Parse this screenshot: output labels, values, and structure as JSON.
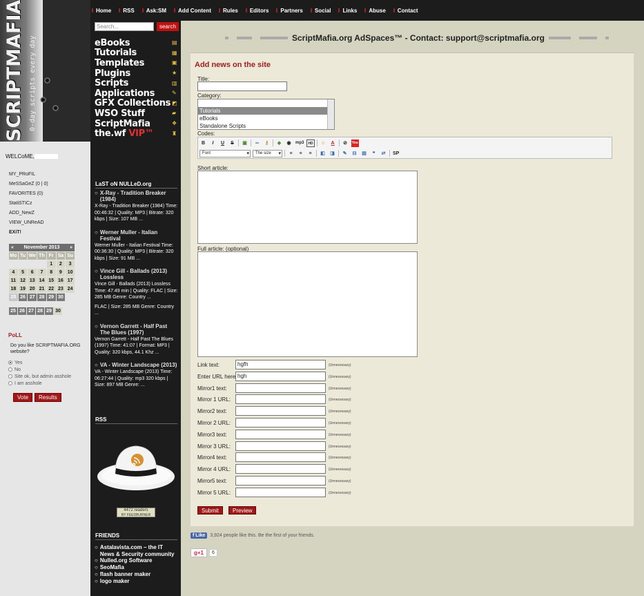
{
  "nav": {
    "items": [
      "Home",
      "RSS",
      "Ask:SM",
      "Add Content",
      "Rules",
      "Editors",
      "Partners",
      "Social",
      "Links",
      "Abuse",
      "Contact"
    ]
  },
  "logo": {
    "title": "SCRIPTMAFIA.ORG",
    "tagline": "0-day scripts every day"
  },
  "user": {
    "welcome": "WELCoME,",
    "menu": [
      "MY_PRoFIL",
      "MeSSaGeZ (0 | 0)",
      "FAVORITES (0)",
      "StatiSTICz",
      "ADD_NewZ",
      "VIEW_UNReAD",
      "EXiT!"
    ]
  },
  "calendar": {
    "month": "November 2013",
    "prev": "«",
    "next": "»",
    "weekdays": [
      "Mo",
      "Tu",
      "We",
      "Th",
      "Fr",
      "Sa",
      "Su"
    ],
    "weeks": [
      [
        "",
        "",
        "",
        "",
        "1",
        "2",
        "3"
      ],
      [
        "4",
        "5",
        "6",
        "7",
        "8",
        "9",
        "10"
      ],
      [
        "11",
        "12",
        "13",
        "14",
        "15",
        "16",
        "17"
      ],
      [
        "18",
        "19",
        "20",
        "21",
        "22",
        "23",
        "24"
      ],
      [
        "25",
        "26",
        "27",
        "28",
        "29",
        "30",
        ""
      ]
    ],
    "extra_row": [
      "25",
      "26",
      "27",
      "28",
      "29",
      "30"
    ]
  },
  "poll": {
    "title": "PoLL",
    "question": "Do you like SCRIPTMAFIA.ORG website?",
    "options": [
      "Yes",
      "No",
      "Site ok, but admin asshole",
      "I am asshole"
    ],
    "vote_label": "Vote",
    "results_label": "Results"
  },
  "search": {
    "placeholder": "Search...",
    "button": "search"
  },
  "categories": [
    {
      "label": "eBooks",
      "icon": "book-icon"
    },
    {
      "label": "Tutorials",
      "icon": "film-icon"
    },
    {
      "label": "Templates",
      "icon": "image-icon"
    },
    {
      "label": "Plugins",
      "icon": "star-icon"
    },
    {
      "label": "Scripts",
      "icon": "document-icon"
    },
    {
      "label": "Applications",
      "icon": "wrench-icon"
    },
    {
      "label": "GFX Collections",
      "icon": "palette-icon"
    },
    {
      "label": "WSO Stuff",
      "icon": "folder-icon"
    },
    {
      "label": "ScriptMafia",
      "icon": "chat-icon"
    },
    {
      "label": "the.wf",
      "label_vip": "VIP™",
      "icon": "bottle-icon"
    }
  ],
  "nulled": {
    "title": "LaST oN NULLeD.org",
    "items": [
      {
        "title": "X-Ray - Tradition Breaker (1984)",
        "body": "X-Ray - Tradition Breaker (1984) Time: 00:46:32 | Quality: MP3 | Bitrate: 320 kbps | Size: 107 MB ..."
      },
      {
        "title": "Werner Muller - Italian Festival",
        "body": "Werner Muller - Italian Festival Time: 00:36:30 | Quality: MP3 | Bitrate: 320 kbps | Size: 91 MB ..."
      },
      {
        "title": "Vince Gill - Ballads (2013) Lossless",
        "body": "Vince Gill - Ballads (2013) Lossless Time: 47:49 min | Quality: FLAC | Size: 285 MB Genre: Country ...",
        "body2": "FLAC | Size: 285 MB Genre: Country ..."
      },
      {
        "title": "Vernon Garrett - Half Past The Blues (1997)",
        "body": "Vernon Garrett - Half Past The Blues (1997) Time: 41:07 | Format: MP3 | Quality: 320 kbps, 44.1 Khz ..."
      },
      {
        "title": "VA - Winter Landscape (2013)",
        "body": "VA - Winter Landscape (2013) Time: 06:27:44 | Quality: mp3 320 kbps | Size: 897 MB Genre: ..."
      }
    ]
  },
  "rss": {
    "title": "RSS",
    "readers": "4472 readers",
    "by": "BY FEEDBURNER"
  },
  "friends": {
    "title": "FRIENDS",
    "items": [
      "Astalavista.com – the IT News & Security community",
      "Nulled.org Software",
      "SeoMafia",
      "flash banner maker",
      "logo maker"
    ]
  },
  "ad": {
    "text": "ScriptMafia.org AdSpaces™ - Contact: support@scriptmafia.org"
  },
  "form": {
    "title": "Add news on the site",
    "title_label": "Title:",
    "category_label": "Category:",
    "category_options": [
      "Tutorials",
      "eBooks",
      "Standalone Scripts"
    ],
    "category_selected": "Tutorials",
    "codes_label": "Codes:",
    "font_select": "Font",
    "size_select": "The size",
    "short_label": "Short article:",
    "full_label": "Full article: (optional)",
    "links": [
      {
        "label": "Link text:",
        "value": "hgfh"
      },
      {
        "label": "Enter URL here:",
        "value": "hgh"
      },
      {
        "label": "Mirror1 text:",
        "value": ""
      },
      {
        "label": "Mirror 1 URL:",
        "value": ""
      },
      {
        "label": "Mirror2 text:",
        "value": ""
      },
      {
        "label": "Mirror 2 URL:",
        "value": ""
      },
      {
        "label": "Mirror3 text:",
        "value": ""
      },
      {
        "label": "Mirror 3 URL:",
        "value": ""
      },
      {
        "label": "Mirror4 text:",
        "value": ""
      },
      {
        "label": "Mirror 4 URL:",
        "value": ""
      },
      {
        "label": "Mirror5 text:",
        "value": ""
      },
      {
        "label": "Mirror 5 URL:",
        "value": ""
      }
    ],
    "unnecessary": "(Unnecessary)",
    "submit_label": "Submit",
    "preview_label": "Preview"
  },
  "social": {
    "like_label": "Like",
    "like_text": "3,924 people like this. Be the first of your friends.",
    "gplus_label": "g+1",
    "gplus_count": "6"
  },
  "colors": {
    "accent_red": "#a01818",
    "dark_bg": "#1c1c1c",
    "panel_bg": "#ece9d8",
    "outer_bg": "#d4d4c0"
  }
}
